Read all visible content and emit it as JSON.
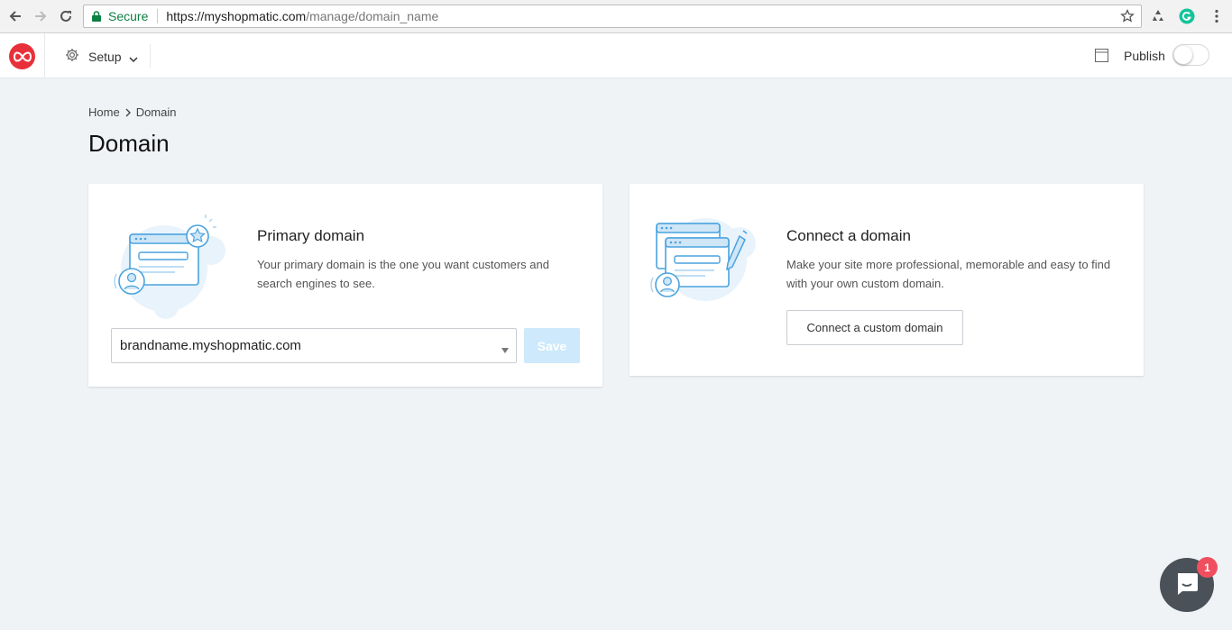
{
  "browser": {
    "secure_label": "Secure",
    "url_host": "https://myshopmatic.com",
    "url_path": "/manage/domain_name"
  },
  "header": {
    "setup_label": "Setup",
    "publish_label": "Publish",
    "publish_on": false
  },
  "breadcrumb": {
    "home": "Home",
    "current": "Domain"
  },
  "page": {
    "title": "Domain"
  },
  "primary_domain": {
    "title": "Primary domain",
    "description": "Your primary domain is the one you want customers and search engines to see.",
    "selected_domain": "brandname.myshopmatic.com",
    "save_label": "Save"
  },
  "connect_domain": {
    "title": "Connect a domain",
    "description": "Make your site more professional,  memorable and easy to find with your own custom domain.",
    "button_label": "Connect a custom domain"
  },
  "chat": {
    "badge_count": "1"
  },
  "colors": {
    "brand_red": "#e8303a",
    "secure_green": "#0b8043",
    "save_disabled": "#cde9fb",
    "illustration_blue": "#4aa3df",
    "chat_bg": "#4a5158",
    "badge_red": "#f04f5f"
  }
}
